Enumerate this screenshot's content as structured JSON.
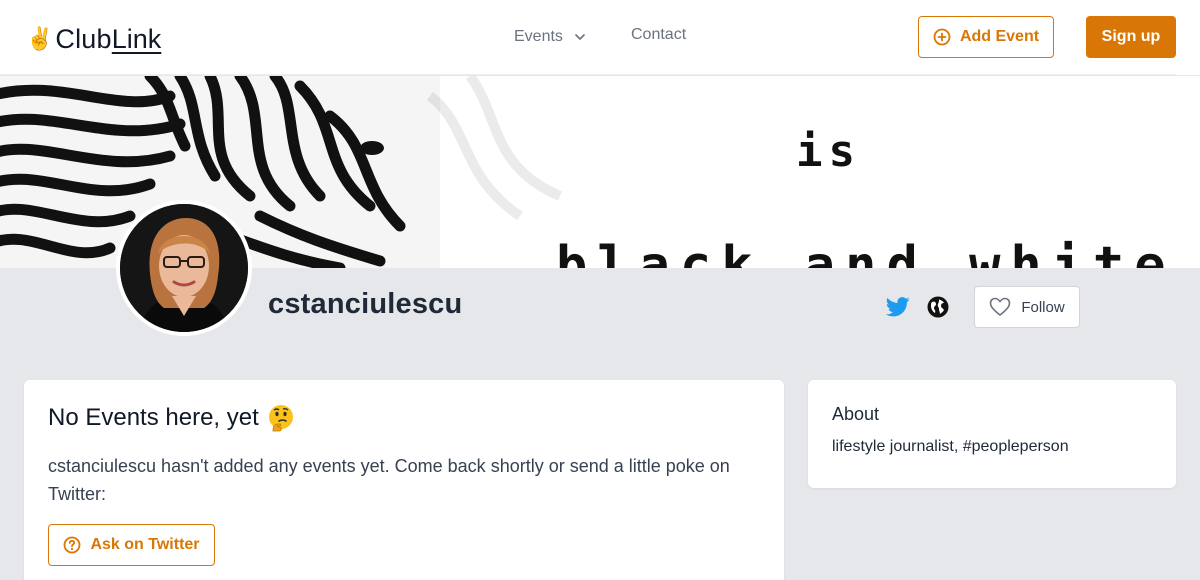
{
  "header": {
    "logo": {
      "emoji": "✌️",
      "part1": "Club",
      "part2": "Link"
    },
    "nav": {
      "events_label": "Events",
      "contact_label": "Contact"
    },
    "add_event_label": "Add Event",
    "signup_label": "Sign up"
  },
  "banner": {
    "word1": "is",
    "word2": "black and white"
  },
  "profile": {
    "username": "cstanciulescu",
    "follow_label": "Follow",
    "icons": [
      "twitter-icon",
      "globe-icon",
      "heart-icon"
    ]
  },
  "events_card": {
    "title": "No Events here, yet",
    "title_emoji": "thinking-face",
    "message": "cstanciulescu hasn't added any events yet. Come back shortly or send a little poke on Twitter:",
    "ask_button_label": "Ask on Twitter"
  },
  "about_card": {
    "heading": "About",
    "text": "lifestyle journalist, #peopleperson"
  },
  "colors": {
    "accent": "#d97706",
    "background": "#e5e7eb",
    "twitter": "#1d9bf0",
    "text": "#1f2937"
  }
}
